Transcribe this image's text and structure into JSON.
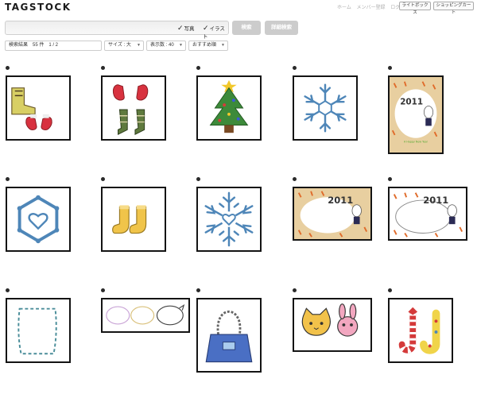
{
  "header": {
    "logo": "TAGSTOCK",
    "nav": [
      "ホーム",
      "メンバー登録",
      "ログイン"
    ],
    "lightbox_label": "ライトボックス",
    "cart_label": "ショッピングカート"
  },
  "search": {
    "value": "",
    "photo_label": "写真",
    "illust_label": "イラスト",
    "photo_checked": true,
    "illust_checked": true,
    "search_button": "検索",
    "advanced_button": "詳細検索"
  },
  "filters": {
    "results_label": "検索結果　55 件　1 / 2",
    "size_label": "サイズ : 大",
    "per_page_label": "表示数 : 40",
    "sort_label": "おすすめ順"
  },
  "thumbnails": [
    {
      "id": "boot-and-mittens",
      "icon": "boot-mittens-icon"
    },
    {
      "id": "mittens-and-legwarmers",
      "icon": "mittens-legwarmers-icon"
    },
    {
      "id": "christmas-tree",
      "icon": "christmas-tree-icon"
    },
    {
      "id": "snowflake-blue",
      "icon": "snowflake-icon"
    },
    {
      "id": "2011-card-portrait",
      "icon": "new-year-card-icon"
    },
    {
      "id": "hexagon-heart",
      "icon": "hexagon-heart-icon"
    },
    {
      "id": "yellow-boots",
      "icon": "boots-icon"
    },
    {
      "id": "snowflake-heart",
      "icon": "snowflake-heart-icon"
    },
    {
      "id": "2011-frame-beige",
      "icon": "new-year-frame-icon"
    },
    {
      "id": "2011-frame-white",
      "icon": "new-year-frame-icon"
    },
    {
      "id": "dashed-frame",
      "icon": "dashed-frame-icon"
    },
    {
      "id": "speech-bubbles",
      "icon": "speech-bubbles-icon"
    },
    {
      "id": "blue-handbag",
      "icon": "handbag-icon"
    },
    {
      "id": "cat-and-rabbit",
      "icon": "cat-rabbit-icon"
    },
    {
      "id": "letter-j-candy",
      "icon": "candy-letters-icon"
    }
  ],
  "new_year_card": {
    "year_text": "2011",
    "caption": "A Happy New Year"
  },
  "colors": {
    "accent_gray": "#cccccc",
    "thumb_border": "#141414",
    "card_beige": "#e8cfa0"
  }
}
